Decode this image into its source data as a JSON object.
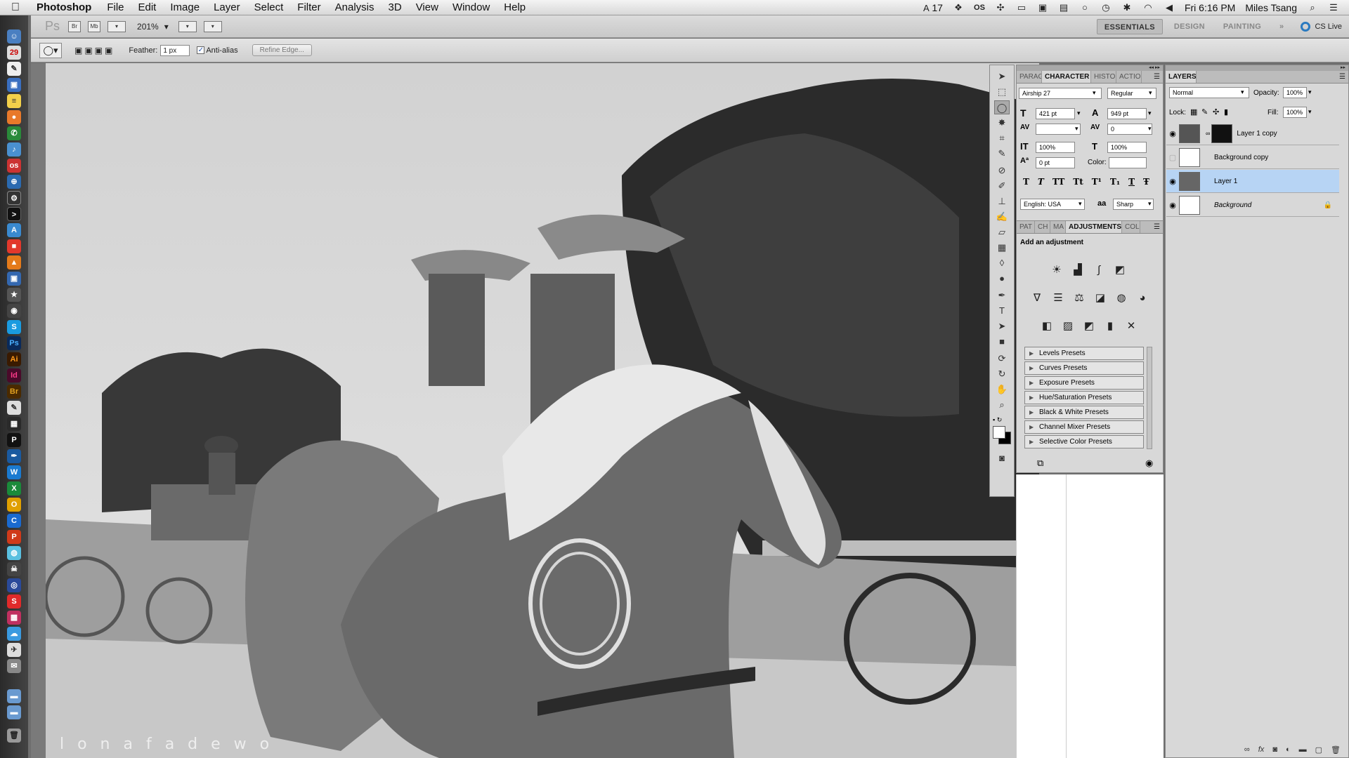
{
  "menubar": {
    "app_name": "Photoshop",
    "items": [
      "File",
      "Edit",
      "Image",
      "Layer",
      "Select",
      "Filter",
      "Analysis",
      "3D",
      "View",
      "Window",
      "Help"
    ],
    "status_num": "17",
    "clock": "Fri 6:16 PM",
    "user": "Miles Tsang"
  },
  "appbar": {
    "logo": "Ps",
    "br": "Br",
    "mb": "Mb",
    "zoom": "201%",
    "workspaces": [
      "ESSENTIALS",
      "DESIGN",
      "PAINTING"
    ],
    "more": "»",
    "cs_live": "CS Live"
  },
  "options": {
    "feather_label": "Feather:",
    "feather_value": "1 px",
    "antialias_label": "Anti-alias",
    "refine_edge": "Refine Edge..."
  },
  "character_panel": {
    "tabs": [
      "PARAG",
      "CHARACTER",
      "HISTO",
      "ACTIO"
    ],
    "font_family": "Airship 27",
    "font_style": "Regular",
    "size": "421 pt",
    "leading": "949 pt",
    "kerning": "",
    "tracking": "0",
    "vscale": "100%",
    "hscale": "100%",
    "baseline": "0 pt",
    "color_label": "Color:",
    "language": "English: USA",
    "aa_label": "aa",
    "antialias": "Sharp",
    "type_buttons": [
      "T",
      "T",
      "TT",
      "Tt",
      "T¹",
      "T₁",
      "T",
      "Ŧ"
    ]
  },
  "adjustments_panel": {
    "tabs": [
      "PAT",
      "CH",
      "MA",
      "ADJUSTMENTS",
      "COL"
    ],
    "heading": "Add an adjustment",
    "presets": [
      "Levels Presets",
      "Curves Presets",
      "Exposure Presets",
      "Hue/Saturation Presets",
      "Black & White Presets",
      "Channel Mixer Presets",
      "Selective Color Presets"
    ]
  },
  "layers_panel": {
    "tab": "LAYERS",
    "blend_mode": "Normal",
    "opacity_label": "Opacity:",
    "opacity": "100%",
    "lock_label": "Lock:",
    "fill_label": "Fill:",
    "fill": "100%",
    "layers": [
      {
        "name": "Layer 1 copy",
        "visible": true,
        "selected": false
      },
      {
        "name": "Background copy",
        "visible": false,
        "selected": false
      },
      {
        "name": "Layer 1",
        "visible": true,
        "selected": true
      },
      {
        "name": "Background",
        "visible": true,
        "selected": false
      }
    ]
  },
  "canvas": {
    "watermark": "l o n a f a d e   w o"
  },
  "colors": {
    "selection": "#b7d4f4",
    "panel": "#d8d8d8",
    "dock": "#333333"
  }
}
